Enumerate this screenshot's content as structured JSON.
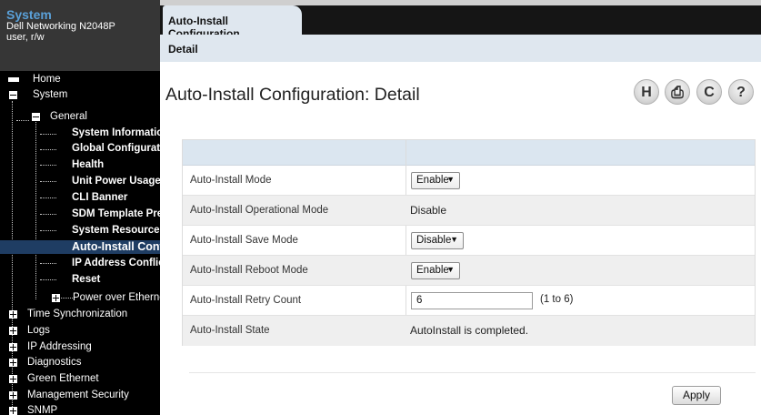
{
  "sidebar": {
    "title": "System",
    "device": "Dell Networking N2048P",
    "user": "user, r/w",
    "tree": [
      {
        "label": "Home"
      },
      {
        "label": "System"
      },
      {
        "label": "General"
      },
      {
        "label": "System Information"
      },
      {
        "label": "Global Configuration"
      },
      {
        "label": "Health"
      },
      {
        "label": "Unit Power Usage History"
      },
      {
        "label": "CLI Banner"
      },
      {
        "label": "SDM Template Preference"
      },
      {
        "label": "System Resources"
      },
      {
        "label": "Auto-Install Configuration",
        "selected": true
      },
      {
        "label": "IP Address Conflict"
      },
      {
        "label": "Reset"
      },
      {
        "label": "Power over Ethernet"
      },
      {
        "label": "Time Synchronization"
      },
      {
        "label": "Logs"
      },
      {
        "label": "IP Addressing"
      },
      {
        "label": "Diagnostics"
      },
      {
        "label": "Green Ethernet"
      },
      {
        "label": "Management Security"
      },
      {
        "label": "SNMP"
      }
    ]
  },
  "header": {
    "tab": "Auto-Install Configuration",
    "subtab": "Detail"
  },
  "page": {
    "title": "Auto-Install Configuration: Detail",
    "icons": {
      "save": "H",
      "print": "⎙",
      "refresh": "C",
      "help": "?"
    }
  },
  "form": {
    "rows": [
      {
        "label": "Auto-Install Mode",
        "value": "Enable"
      },
      {
        "label": "Auto-Install Operational Mode",
        "value": "Disable"
      },
      {
        "label": "Auto-Install Save Mode",
        "value": "Disable"
      },
      {
        "label": "Auto-Install Reboot Mode",
        "value": "Enable"
      },
      {
        "label": "Auto-Install Retry Count",
        "value": "6",
        "hint": "(1 to 6)"
      },
      {
        "label": "Auto-Install State",
        "value": "AutoInstall is completed."
      }
    ],
    "dropdown_arrow": "▼"
  },
  "buttons": {
    "apply": "Apply"
  }
}
